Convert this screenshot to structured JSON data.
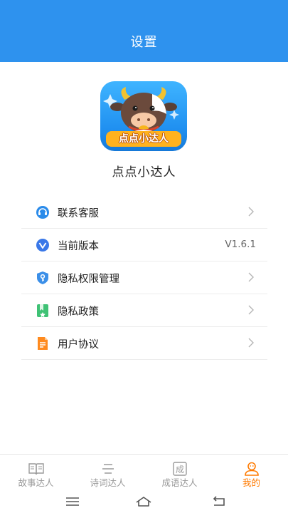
{
  "header": {
    "title": "设置"
  },
  "app": {
    "icon_banner": "点点小达人",
    "name": "点点小达人"
  },
  "menu": [
    {
      "label": "联系客服",
      "icon": "headset-icon",
      "icon_color": "#2a8bea",
      "value": ""
    },
    {
      "label": "当前版本",
      "icon": "version-icon",
      "icon_color": "#3a78e8",
      "value": "V1.6.1"
    },
    {
      "label": "隐私权限管理",
      "icon": "shield-key-icon",
      "icon_color": "#3b8fe8",
      "value": ""
    },
    {
      "label": "隐私政策",
      "icon": "bookmark-star-icon",
      "icon_color": "#3fc275",
      "value": ""
    },
    {
      "label": "用户协议",
      "icon": "document-icon",
      "icon_color": "#ff8a1e",
      "value": ""
    }
  ],
  "tabs": [
    {
      "label": "故事达人",
      "icon": "book-icon",
      "active": false
    },
    {
      "label": "诗词达人",
      "icon": "poem-icon",
      "active": false
    },
    {
      "label": "成语达人",
      "icon": "idiom-icon",
      "icon_char": "成",
      "active": false
    },
    {
      "label": "我的",
      "icon": "profile-icon",
      "active": true
    }
  ],
  "colors": {
    "header_bg": "#2e92ee",
    "active_tab": "#ff7a00",
    "inactive_tab": "#999999"
  }
}
